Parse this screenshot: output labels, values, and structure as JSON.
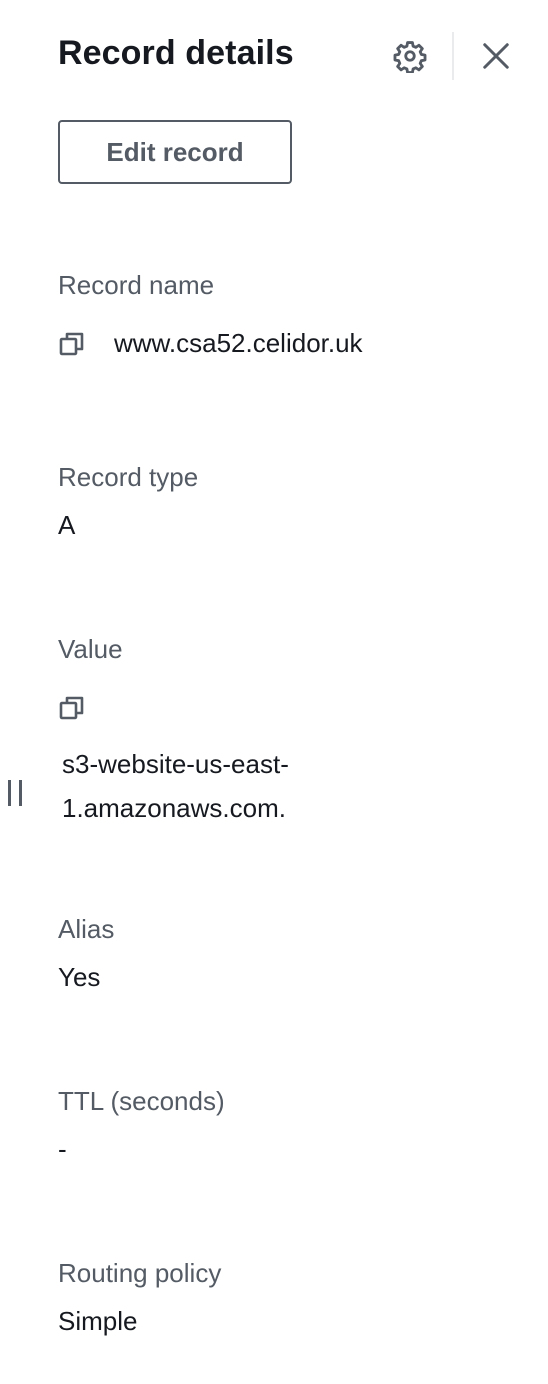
{
  "header": {
    "title": "Record details",
    "settings_icon": "gear-icon",
    "close_icon": "close-icon"
  },
  "actions": {
    "edit_label": "Edit record"
  },
  "fields": {
    "record_name": {
      "label": "Record name",
      "value": "www.csa52.celidor.uk",
      "copy_icon": "copy-icon"
    },
    "record_type": {
      "label": "Record type",
      "value": "A"
    },
    "value": {
      "label": "Value",
      "line1": "s3-website-us-east-",
      "line2": "1.amazonaws.com.",
      "copy_icon": "copy-icon"
    },
    "alias": {
      "label": "Alias",
      "value": "Yes"
    },
    "ttl": {
      "label": "TTL (seconds)",
      "value": "-"
    },
    "routing_policy": {
      "label": "Routing policy",
      "value": "Simple"
    }
  },
  "colors": {
    "text_primary": "#16191f",
    "text_secondary": "#545b64",
    "divider": "#e9ebed"
  }
}
